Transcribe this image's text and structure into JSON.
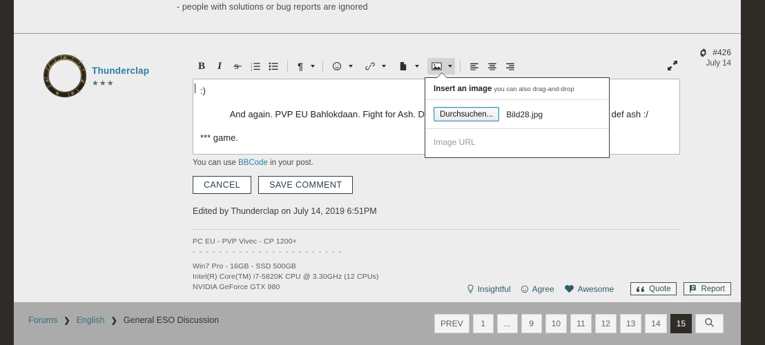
{
  "top_snippet": {
    "text": "- people with solutions or bug reports are ignored"
  },
  "post": {
    "author": {
      "name": "Thunderclap",
      "rank_stars": "★★★",
      "avatar_icon": "eso-ouroboros-logo"
    },
    "meta": {
      "gear_icon": "gear-icon",
      "number": "#426",
      "date": "July 14"
    },
    "editor": {
      "toolbar": [
        {
          "name": "bold",
          "glyph": "B"
        },
        {
          "name": "italic",
          "glyph": "I"
        },
        {
          "name": "strikethrough",
          "glyph": "S"
        },
        {
          "name": "ordered-list",
          "glyph": "list-ol-icon"
        },
        {
          "name": "unordered-list",
          "glyph": "list-ul-icon"
        },
        {
          "name": "paragraph",
          "glyph": "¶"
        },
        {
          "name": "emoji",
          "glyph": "smiley-icon"
        },
        {
          "name": "link",
          "glyph": "link-icon"
        },
        {
          "name": "document",
          "glyph": "file-icon"
        },
        {
          "name": "image",
          "glyph": "image-icon"
        },
        {
          "name": "align-left",
          "glyph": "align-left-icon"
        },
        {
          "name": "align-center",
          "glyph": "align-center-icon"
        },
        {
          "name": "align-right",
          "glyph": "align-right-icon"
        },
        {
          "name": "expand",
          "glyph": "expand-icon"
        }
      ],
      "body_line1": ":)",
      "body_line2_left": "And again. PVP EU Bahlokdaan. Fight for Ash. During the fight, pin",
      "body_line2_right": "blue def ash :/",
      "body_line3": "*** game.",
      "bbcode_prefix": "You can use ",
      "bbcode_link": "BBCode",
      "bbcode_suffix": " in your post.",
      "cancel_label": "CANCEL",
      "save_label": "SAVE COMMENT"
    },
    "edited_line": "Edited by Thunderclap on July 14, 2019 6:51PM",
    "signature": [
      "PC EU - PVP Vivec - CP 1200+",
      "- - - - - - - - - - - - - - - - - - - - - - -",
      "",
      "Win7 Pro - 16GB - SSD 500GB",
      "Intel(R) Core(TM) i7-5820K CPU @ 3.30GHz (12 CPUs)",
      "NVIDIA GeForce GTX 980"
    ],
    "reactions": [
      {
        "name": "insightful",
        "label": "Insightful",
        "icon": "lightbulb-icon"
      },
      {
        "name": "agree",
        "label": "Agree",
        "icon": "smiley-icon"
      },
      {
        "name": "awesome",
        "label": "Awesome",
        "icon": "heart-icon"
      }
    ],
    "actions": [
      {
        "name": "quote",
        "label": "Quote",
        "icon": "quote-icon"
      },
      {
        "name": "report",
        "label": "Report",
        "icon": "flag-icon"
      }
    ]
  },
  "image_popup": {
    "title": "Insert an image",
    "hint": "you can also drag-and-drop",
    "browse_label": "Durchsuchen...",
    "file_name": "Bild28.jpg",
    "url_placeholder": "Image URL"
  },
  "footer": {
    "breadcrumb": [
      {
        "label": "Forums",
        "link": true
      },
      {
        "label": "English",
        "link": true
      },
      {
        "label": "General ESO Discussion",
        "link": false
      }
    ],
    "breadcrumb_separator": "❯",
    "pagination": [
      {
        "label": "PREV",
        "kind": "prev"
      },
      {
        "label": "1",
        "kind": "page"
      },
      {
        "label": "...",
        "kind": "ellipsis"
      },
      {
        "label": "9",
        "kind": "page"
      },
      {
        "label": "10",
        "kind": "page"
      },
      {
        "label": "11",
        "kind": "page"
      },
      {
        "label": "12",
        "kind": "page"
      },
      {
        "label": "13",
        "kind": "page"
      },
      {
        "label": "14",
        "kind": "page"
      },
      {
        "label": "15",
        "kind": "active"
      },
      {
        "label": "search-icon",
        "kind": "search"
      }
    ]
  },
  "colors": {
    "frame": "#2f2c27",
    "content_bg": "#ededed",
    "footer_bg": "#ababab",
    "link": "#2b7fa3",
    "accent_teal": "#2f5d66"
  }
}
